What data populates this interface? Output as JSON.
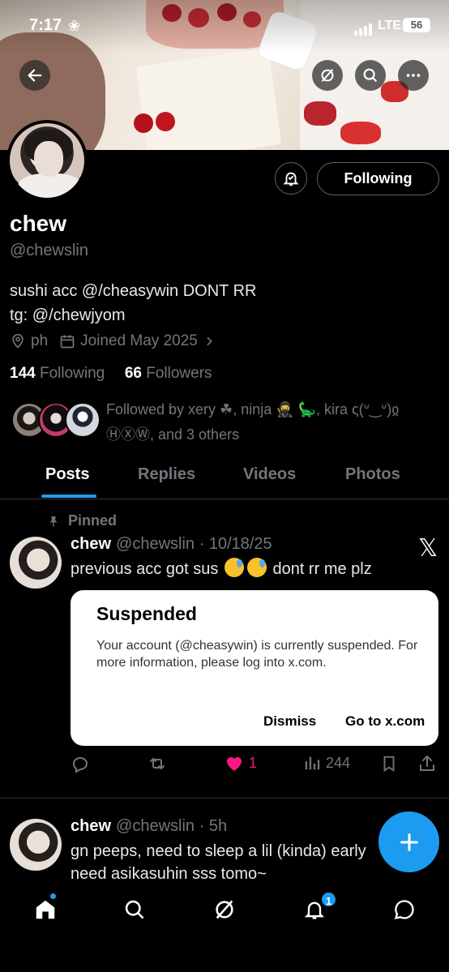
{
  "status_bar": {
    "time": "7:17",
    "network": "LTE",
    "battery": "56"
  },
  "profile": {
    "name": "chew",
    "handle": "@chewslin",
    "bio_lines": [
      "sushi acc @/cheasywin DONT RR",
      "tg: @/chewjyom"
    ],
    "location": "ph",
    "joined": "Joined May 2025",
    "following_count": "144",
    "following_label": "Following",
    "followers_count": "66",
    "followers_label": "Followers",
    "followed_by": "Followed by xery ☘, ninja 🥷 🦕, kira ς(ᐡ‿ᐡ)ჲ ⒽⓍⓌ, and 3 others",
    "follow_button": "Following"
  },
  "tabs": [
    {
      "label": "Posts",
      "active": true
    },
    {
      "label": "Replies",
      "active": false
    },
    {
      "label": "Videos",
      "active": false
    },
    {
      "label": "Photos",
      "active": false
    }
  ],
  "posts": [
    {
      "pinned_label": "Pinned",
      "name": "chew",
      "handle": "@chewslin",
      "date": "10/18/25",
      "text_before": "previous acc got sus",
      "text_after": "dont rr me plz",
      "likes": "1",
      "views": "244"
    },
    {
      "name": "chew",
      "handle": "@chewslin",
      "date": "5h",
      "lines": [
        "gn peeps, need to sleep a lil (kinda) early",
        "need asikasuhin sss tomo~"
      ]
    }
  ],
  "dialog": {
    "title": "Suspended",
    "message": "Your account (@cheasywin) is currently suspended. For more information, please log into x.com.",
    "dismiss": "Dismiss",
    "goto": "Go to x.com"
  },
  "notifications_badge": "1",
  "colors": {
    "accent": "#1d9bf0",
    "like": "#f91880",
    "muted": "#71767b"
  }
}
